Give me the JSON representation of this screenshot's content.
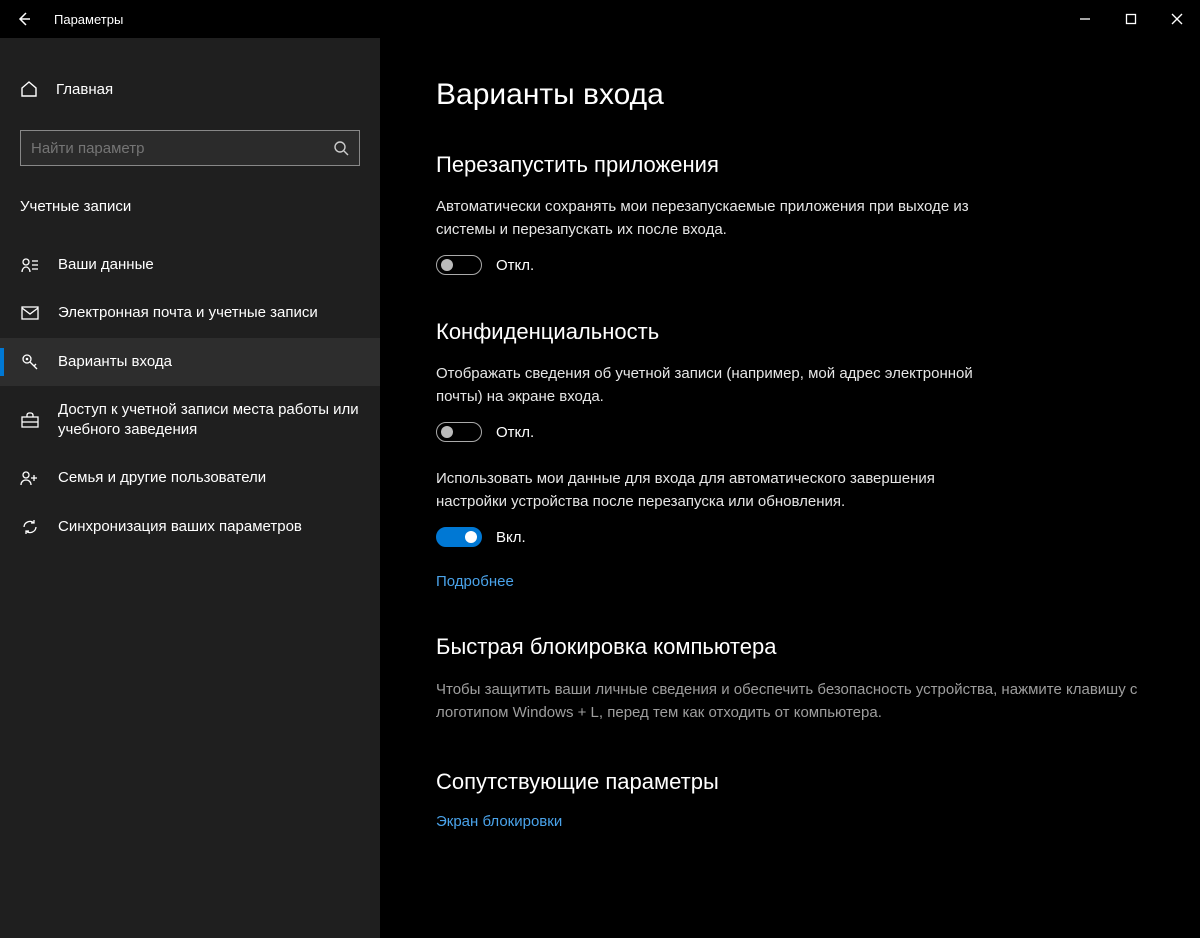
{
  "titlebar": {
    "title": "Параметры"
  },
  "sidebar": {
    "home": "Главная",
    "search_placeholder": "Найти параметр",
    "category": "Учетные записи",
    "items": [
      {
        "label": "Ваши данные"
      },
      {
        "label": "Электронная почта и учетные записи"
      },
      {
        "label": "Варианты входа"
      },
      {
        "label": "Доступ к учетной записи места работы или учебного заведения"
      },
      {
        "label": "Семья и другие пользователи"
      },
      {
        "label": "Синхронизация ваших параметров"
      }
    ]
  },
  "main": {
    "title": "Варианты входа",
    "restart": {
      "heading": "Перезапустить приложения",
      "desc": "Автоматически сохранять мои перезапускаемые приложения при выходе из системы и перезапускать их после входа.",
      "state": "Откл."
    },
    "privacy": {
      "heading": "Конфиденциальность",
      "t1_desc": "Отображать сведения об учетной записи (например, мой адрес электронной почты) на экране входа.",
      "t1_state": "Откл.",
      "t2_desc": "Использовать мои данные для входа для автоматического завершения настройки устройства после перезапуска или обновления.",
      "t2_state": "Вкл.",
      "more": "Подробнее"
    },
    "lock": {
      "heading": "Быстрая блокировка компьютера",
      "desc": "Чтобы защитить ваши личные сведения и обеспечить безопасность устройства, нажмите клавишу с логотипом Windows + L, перед тем как отходить от компьютера."
    },
    "related": {
      "heading": "Сопутствующие параметры",
      "link": "Экран блокировки"
    }
  }
}
